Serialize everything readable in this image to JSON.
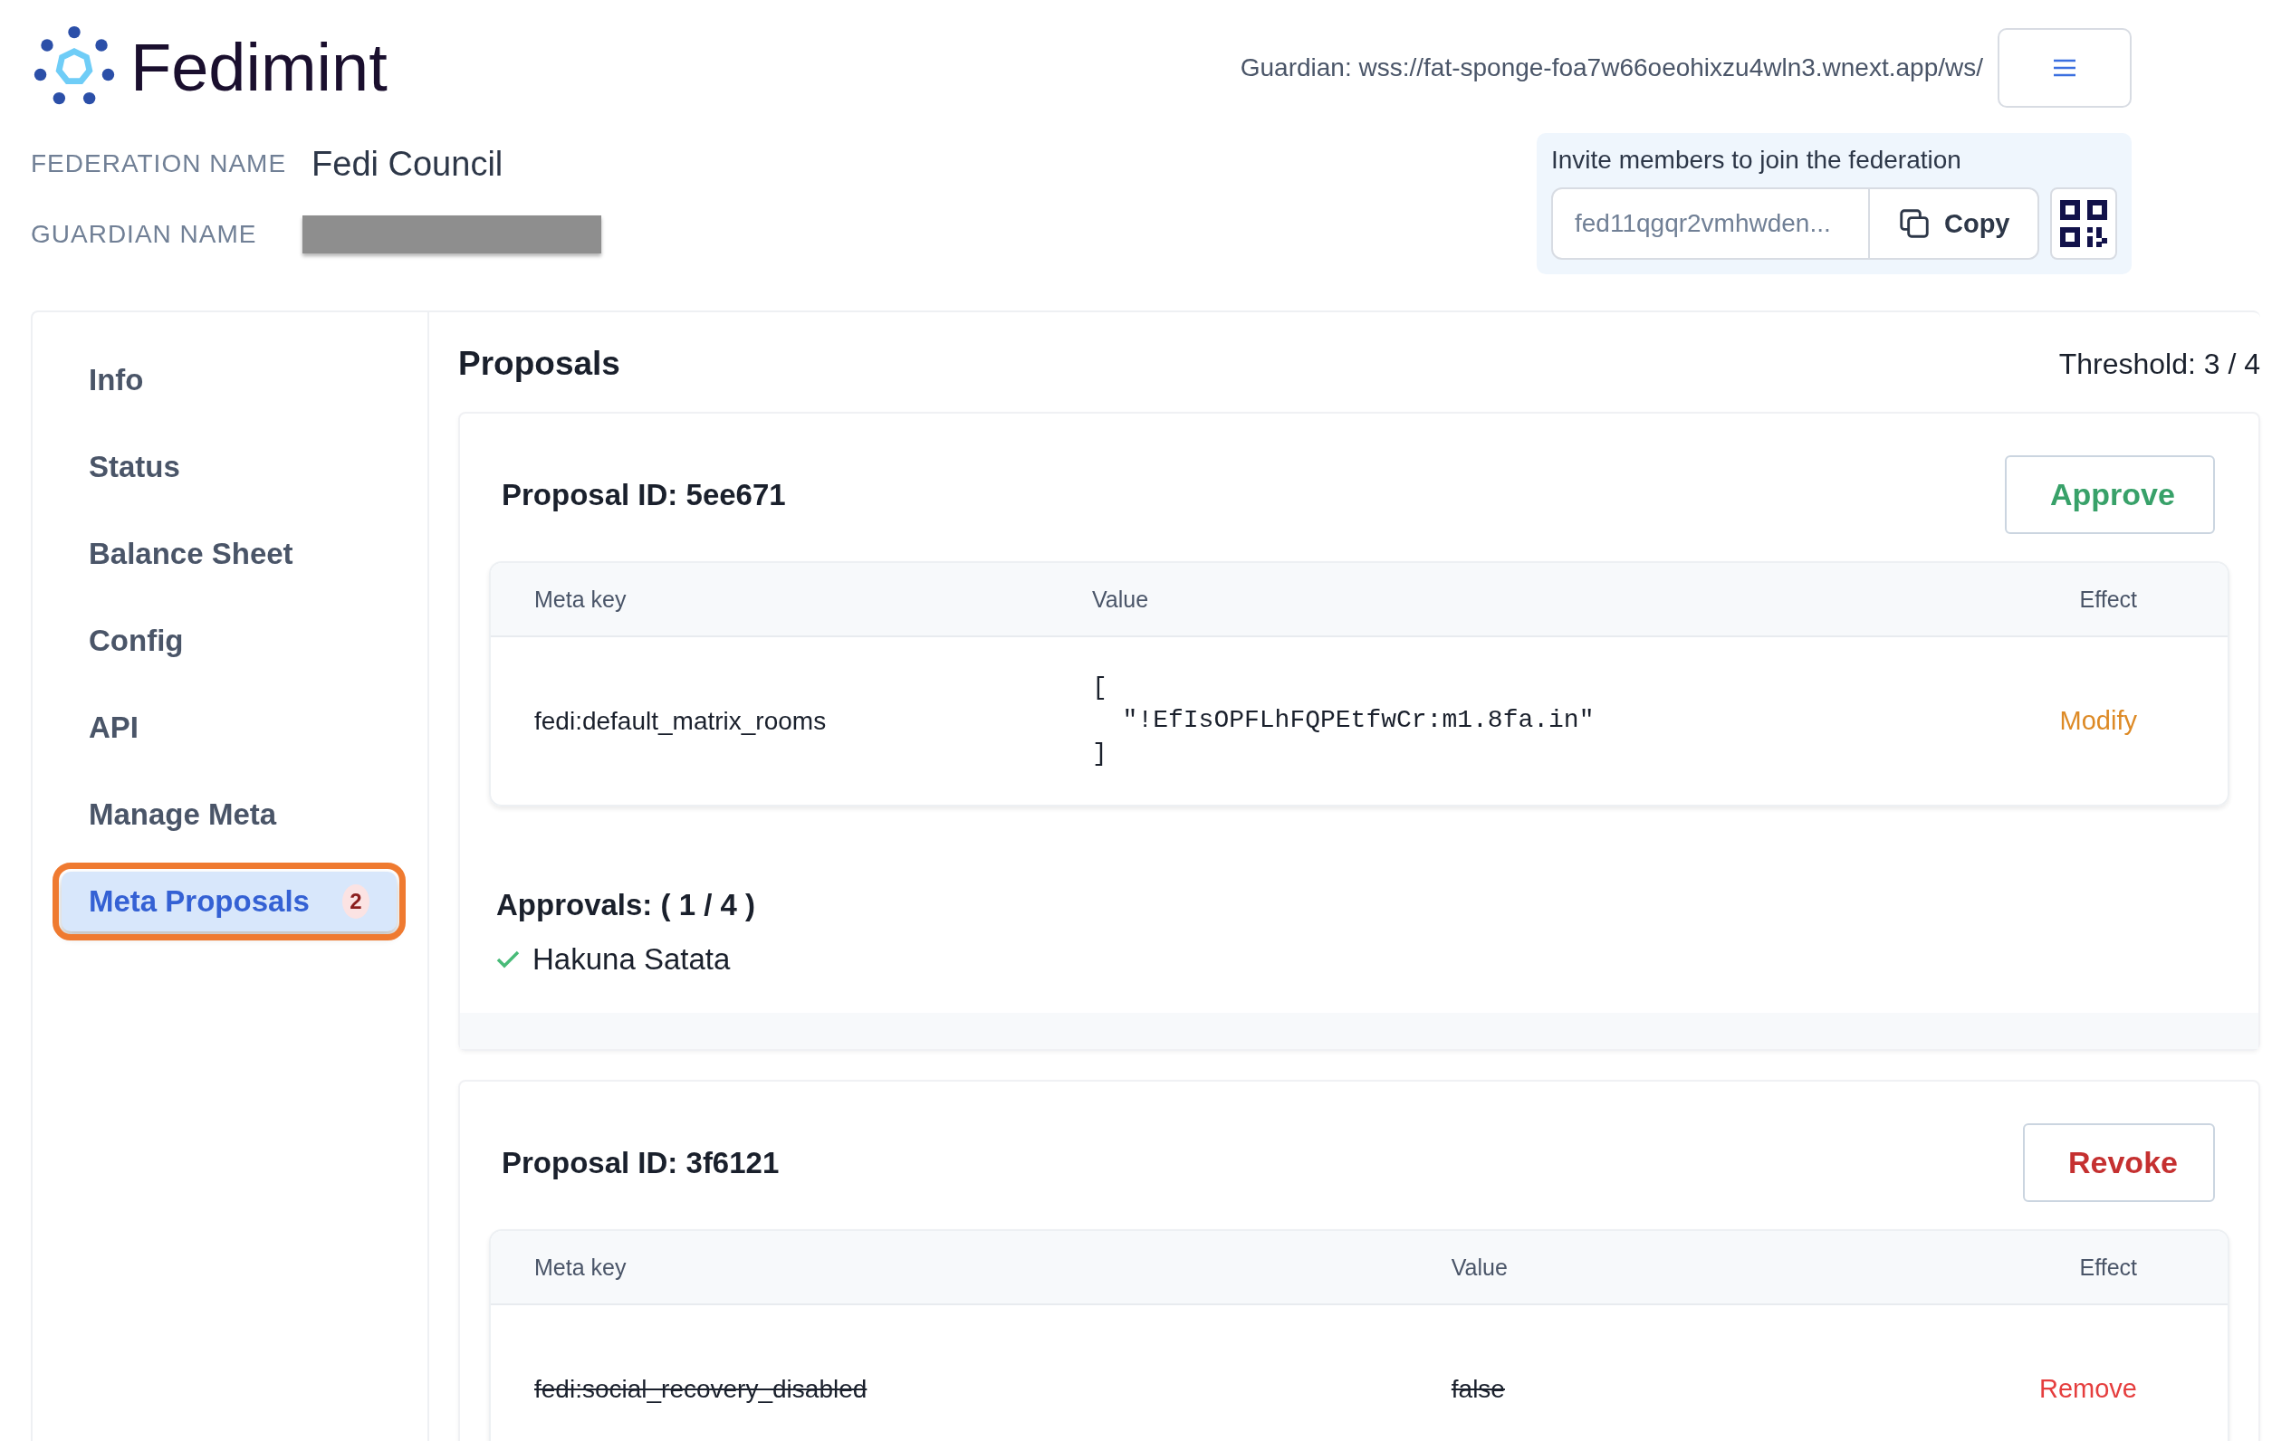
{
  "header": {
    "logo_text": "Fedimint",
    "guardian_url": "Guardian: wss://fat-sponge-foa7w66oeohixzu4wln3.wnext.app/ws/"
  },
  "federation": {
    "label": "FEDERATION NAME",
    "value": "Fedi Council"
  },
  "guardian": {
    "label": "GUARDIAN NAME",
    "redacted": true
  },
  "invite": {
    "title": "Invite members to join the federation",
    "code": "fed11qgqr2vmhwden...",
    "copy_label": "Copy"
  },
  "sidebar": {
    "items": [
      {
        "label": "Info",
        "selected": false
      },
      {
        "label": "Status",
        "selected": false
      },
      {
        "label": "Balance Sheet",
        "selected": false
      },
      {
        "label": "Config",
        "selected": false
      },
      {
        "label": "API",
        "selected": false
      },
      {
        "label": "Manage Meta",
        "selected": false
      },
      {
        "label": "Meta Proposals",
        "selected": true,
        "badge": "2",
        "annotated": true
      }
    ]
  },
  "page": {
    "title": "Proposals",
    "threshold": "Threshold: 3 / 4"
  },
  "proposals": [
    {
      "title": "Proposal ID: 5ee671",
      "action": {
        "label": "Approve",
        "kind": "approve"
      },
      "columns": [
        "Meta key",
        "Value",
        "Effect"
      ],
      "rows": [
        {
          "key": "fedi:default_matrix_rooms",
          "value": {
            "kind": "code",
            "text": "[\n  \"!EfIsOPFLhFQPEtfwCr:m1.8fa.in\"\n]"
          },
          "effect": {
            "kind": "modify",
            "label": "Modify"
          },
          "struck": false
        }
      ],
      "approvals": {
        "title": "Approvals: ( 1 / 4 )",
        "names": [
          "Hakuna Satata"
        ]
      }
    },
    {
      "title": "Proposal ID: 3f6121",
      "action": {
        "label": "Revoke",
        "kind": "revoke"
      },
      "columns": [
        "Meta key",
        "Value",
        "Effect"
      ],
      "rows": [
        {
          "key": "fedi:social_recovery_disabled",
          "value": {
            "kind": "text",
            "text": "false"
          },
          "effect": {
            "kind": "remove",
            "label": "Remove"
          },
          "struck": true
        }
      ]
    }
  ]
}
